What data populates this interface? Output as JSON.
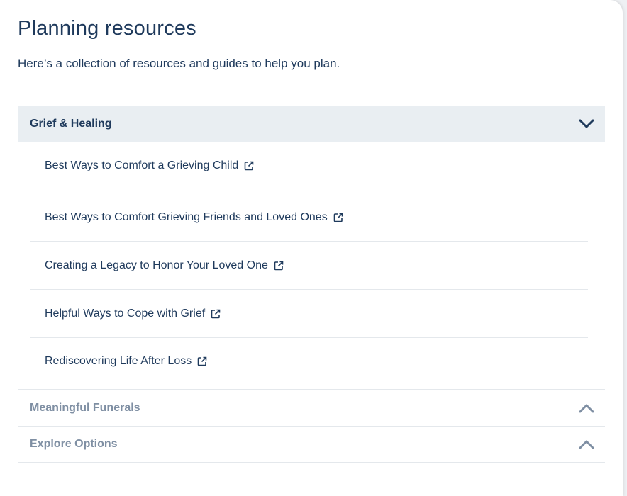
{
  "page": {
    "title": "Planning resources",
    "subtitle": "Here’s a collection of resources and guides to help you plan."
  },
  "sections": [
    {
      "title": "Grief & Healing",
      "state": "expanded",
      "icon": "chevron-down-icon",
      "items": [
        {
          "label": "Best Ways to Comfort a Grieving Child",
          "icon": "external-link-icon"
        },
        {
          "label": "Best Ways to Comfort Grieving Friends and Loved Ones",
          "icon": "external-link-icon"
        },
        {
          "label": "Creating a Legacy to Honor Your Loved One",
          "icon": "external-link-icon"
        },
        {
          "label": "Helpful Ways to Cope with Grief",
          "icon": "external-link-icon"
        },
        {
          "label": "Rediscovering Life After Loss",
          "icon": "external-link-icon"
        }
      ]
    },
    {
      "title": "Meaningful Funerals",
      "state": "collapsed",
      "icon": "chevron-up-icon"
    },
    {
      "title": "Explore Options",
      "state": "collapsed",
      "icon": "chevron-up-icon"
    }
  ],
  "colors": {
    "text": "#1f3a5c",
    "muted_text": "#7f8fa3",
    "header_bg": "#e9eef2",
    "divider": "#e4e8ec"
  }
}
